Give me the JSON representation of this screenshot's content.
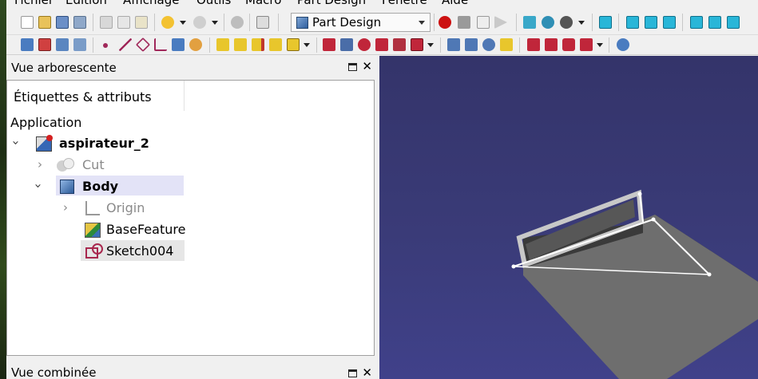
{
  "menu": {
    "items": [
      "Fichier",
      "Édition",
      "Affichage",
      "Outils",
      "Macro",
      "Part Design",
      "Fenêtre",
      "Aide"
    ]
  },
  "toolbar": {
    "workbench": "Part Design"
  },
  "tree_panel": {
    "title": "Vue arborescente",
    "column_header": "Étiquettes & attributs",
    "root_label": "Application",
    "items": [
      {
        "label": "aspirateur_2",
        "bold": true,
        "icon": "document-icon"
      },
      {
        "label": "Cut",
        "muted": true,
        "icon": "cut-icon"
      },
      {
        "label": "Body",
        "bold": true,
        "icon": "body-icon"
      },
      {
        "label": "Origin",
        "muted": true,
        "icon": "origin-icon"
      },
      {
        "label": "BaseFeature",
        "icon": "base-feature-icon"
      },
      {
        "label": "Sketch004",
        "icon": "sketch-icon"
      }
    ]
  },
  "bottom_panel": {
    "title": "Vue combinée"
  },
  "colors": {
    "view_bg_top": "#34346a",
    "view_bg_bottom": "#40418a",
    "selection": "#e3e3f7",
    "record_red": "#cc1111",
    "cyan_view": "#29b6d8"
  },
  "labels": {
    "float": "float-icon",
    "close": "✕"
  }
}
